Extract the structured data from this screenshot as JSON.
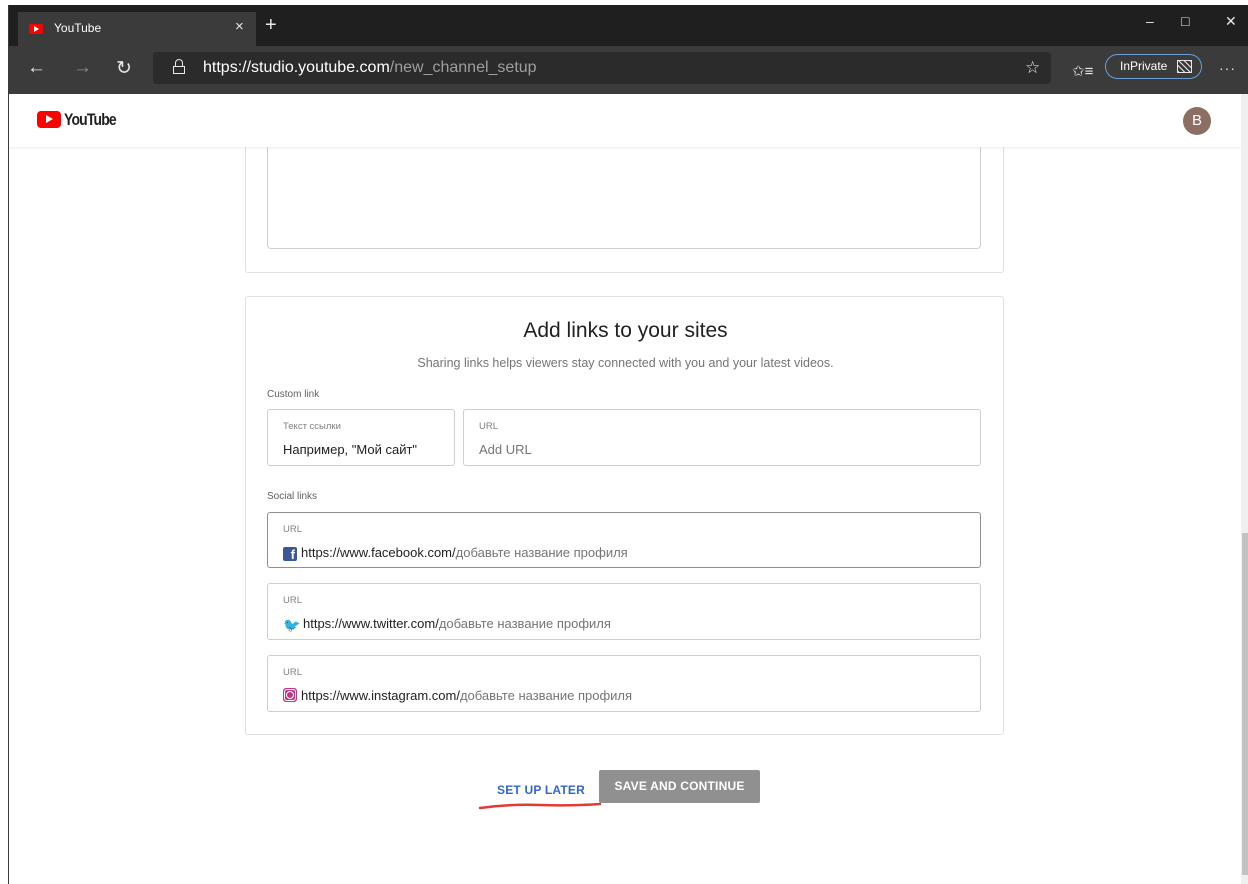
{
  "browser": {
    "tab_title": "YouTube",
    "tab_close": "×",
    "new_tab": "+",
    "window_controls": {
      "minimize": "–",
      "maximize": "□",
      "close": "✕"
    },
    "nav": {
      "back": "←",
      "forward": "→",
      "refresh": "↻"
    },
    "address": {
      "host": "https://studio.youtube.com",
      "path": "/new_channel_setup"
    },
    "inprivate_label": "InPrivate",
    "more": "···"
  },
  "header": {
    "logo_text": "YouTube",
    "avatar_letter": "B"
  },
  "links_card": {
    "title": "Add links to your sites",
    "subtitle": "Sharing links helps viewers stay connected with you and your latest videos.",
    "custom_label": "Custom link",
    "custom_text": {
      "label": "Текст ссылки",
      "placeholder": "Например, \"Мой сайт\""
    },
    "custom_url": {
      "label": "URL",
      "placeholder": "Add URL"
    },
    "social_label": "Social links",
    "social": [
      {
        "label": "URL",
        "icon": "facebook-icon",
        "domain": "https://www.facebook.com/",
        "hint": "добавьте название профиля"
      },
      {
        "label": "URL",
        "icon": "twitter-icon",
        "domain": "https://www.twitter.com/",
        "hint": "добавьте название профиля"
      },
      {
        "label": "URL",
        "icon": "instagram-icon",
        "domain": "https://www.instagram.com/",
        "hint": "добавьте название профиля"
      }
    ]
  },
  "actions": {
    "later": "SET UP LATER",
    "save": "SAVE AND CONTINUE"
  },
  "colors": {
    "accent": "#3366cc",
    "annotation": "#e53935",
    "button_disabled": "#909090",
    "youtube_red": "#ff0000"
  }
}
